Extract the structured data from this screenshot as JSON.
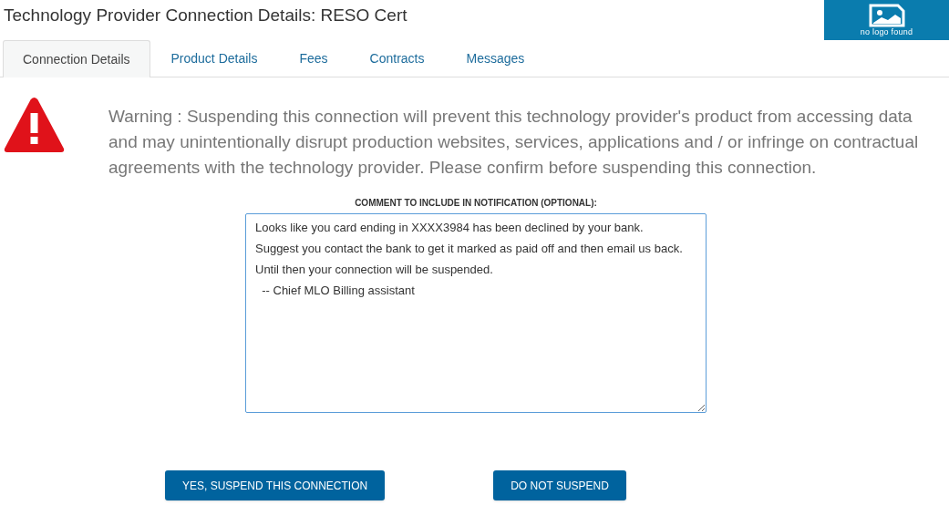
{
  "title": "Technology Provider Connection Details: RESO Cert",
  "logo": {
    "caption": "no logo found"
  },
  "tabs": [
    {
      "label": "Connection Details",
      "selected": true
    },
    {
      "label": "Product Details",
      "selected": false
    },
    {
      "label": "Fees",
      "selected": false
    },
    {
      "label": "Contracts",
      "selected": false
    },
    {
      "label": "Messages",
      "selected": false
    }
  ],
  "warning": "Warning : Suspending this connection will prevent this technology provider's product from accessing data and may unintentionally disrupt production websites, services, applications and / or infringe on contractual agreements with the technology provider. Please confirm before suspending this connection.",
  "comment": {
    "label": "COMMENT TO INCLUDE IN NOTIFICATION (OPTIONAL):",
    "value": "Looks like you card ending in XXXX3984 has been declined by your bank.\nSuggest you contact the bank to get it marked as paid off and then email us back. Until then your connection will be suspended.\n  -- Chief MLO Billing assistant"
  },
  "buttons": [
    "YES, SUSPEND THIS CONNECTION",
    "DO NOT SUSPEND"
  ]
}
